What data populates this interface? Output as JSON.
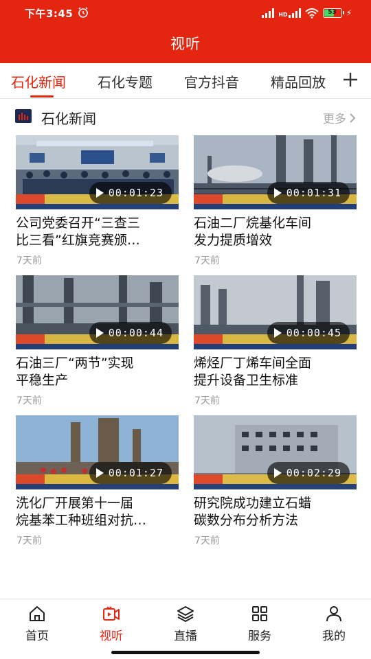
{
  "status_bar": {
    "time": "下午3:45",
    "network_label": "HD",
    "battery_level": "53",
    "icons": [
      "alarm-icon",
      "signal-icon",
      "signal-hd-icon",
      "wifi-icon",
      "battery-icon",
      "charging-icon"
    ]
  },
  "header": {
    "title": "视听"
  },
  "tabs": [
    {
      "label": "石化新闻",
      "active": true
    },
    {
      "label": "石化专题",
      "active": false
    },
    {
      "label": "官方抖音",
      "active": false
    },
    {
      "label": "精品回放",
      "active": false
    }
  ],
  "section": {
    "title": "石化新闻",
    "more_label": "更多"
  },
  "videos": [
    {
      "title_line1": "公司党委召开“三查三",
      "title_line2": "比三看”红旗竞赛颁…",
      "duration": "00:01:23",
      "time": "7天前"
    },
    {
      "title_line1": "石油二厂烷基化车间",
      "title_line2": "发力提质增效",
      "duration": "00:01:31",
      "time": "7天前"
    },
    {
      "title_line1": "石油三厂“两节”实现",
      "title_line2": "平稳生产",
      "duration": "00:00:44",
      "time": "7天前"
    },
    {
      "title_line1": "烯烃厂丁烯车间全面",
      "title_line2": "提升设备卫生标准",
      "duration": "00:00:45",
      "time": "7天前"
    },
    {
      "title_line1": "洗化厂开展第十一届",
      "title_line2": "烷基苯工种班组对抗…",
      "duration": "00:01:27",
      "time": "7天前"
    },
    {
      "title_line1": "研究院成功建立石蜡",
      "title_line2": "碳数分布分析方法",
      "duration": "00:02:29",
      "time": "7天前"
    }
  ],
  "bottom_nav": [
    {
      "label": "首页",
      "icon": "home-icon",
      "active": false
    },
    {
      "label": "视听",
      "icon": "video-icon",
      "active": true
    },
    {
      "label": "直播",
      "icon": "layers-icon",
      "active": false
    },
    {
      "label": "服务",
      "icon": "grid-icon",
      "active": false
    },
    {
      "label": "我的",
      "icon": "user-icon",
      "active": false
    }
  ],
  "colors": {
    "brand_red": "#e4250f",
    "muted_text": "#999999"
  }
}
